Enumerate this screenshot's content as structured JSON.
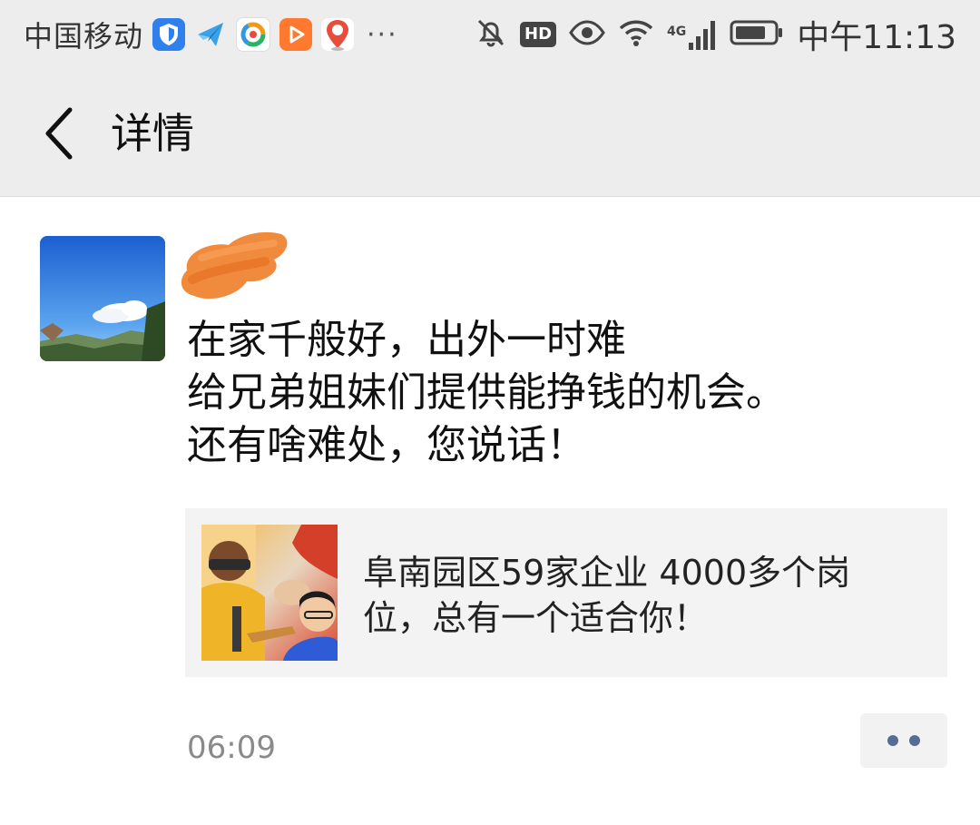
{
  "status_bar": {
    "carrier": "中国移动",
    "app_icons": [
      "shield-app-icon",
      "paper-plane-app-icon",
      "ring-app-icon",
      "video-play-app-icon",
      "map-pin-app-icon"
    ],
    "more": "···",
    "hd": "HD",
    "network": "4G",
    "time": "中午11:13"
  },
  "header": {
    "title": "详情"
  },
  "post": {
    "username": "",
    "text_lines": [
      "在家千般好，出外一时难",
      "给兄弟姐妹们提供能挣钱的机会。",
      "还有啥难处，您说话！"
    ],
    "link": {
      "title": "阜南园区59家企业 4000多个岗位，总有一个适合你！"
    },
    "time": "06:09"
  },
  "colors": {
    "bar_bg": "#ededed",
    "username": "#576b95",
    "link_bg": "#f3f3f3",
    "time_text": "#8a8a8a"
  }
}
